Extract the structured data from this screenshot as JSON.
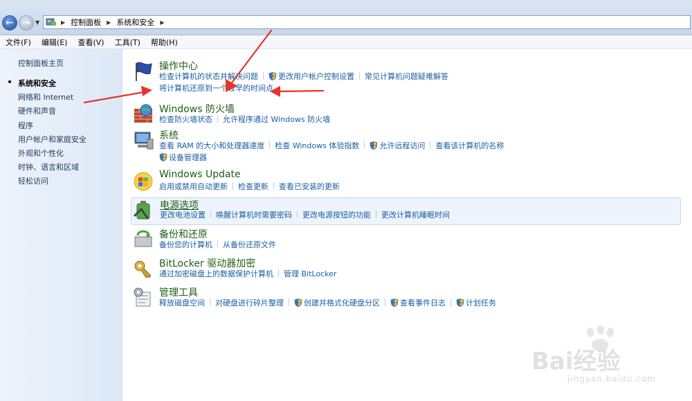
{
  "breadcrumb": {
    "items": [
      "控制面板",
      "系统和安全"
    ]
  },
  "menu": {
    "items": [
      "文件(F)",
      "编辑(E)",
      "查看(V)",
      "工具(T)",
      "帮助(H)"
    ]
  },
  "sidebar": {
    "home": "控制面板主页",
    "items": [
      "系统和安全",
      "网络和 Internet",
      "硬件和声音",
      "程序",
      "用户帐户和家庭安全",
      "外观和个性化",
      "时钟、语言和区域",
      "轻松访问"
    ],
    "current_index": 0
  },
  "categories": [
    {
      "title": "操作中心",
      "icon": "flag-icon",
      "links": [
        {
          "text": "检查计算机的状态并解决问题",
          "shield": false
        },
        {
          "text": "更改用户帐户控制设置",
          "shield": true
        },
        {
          "text": "常见计算机问题疑难解答",
          "shield": false
        },
        {
          "text": "将计算机还原到一个较早的时间点",
          "shield": false,
          "newline": true
        }
      ]
    },
    {
      "title": "Windows 防火墙",
      "icon": "firewall-icon",
      "links": [
        {
          "text": "检查防火墙状态",
          "shield": false
        },
        {
          "text": "允许程序通过 Windows 防火墙",
          "shield": false
        }
      ]
    },
    {
      "title": "系统",
      "icon": "computer-icon",
      "links": [
        {
          "text": "查看 RAM 的大小和处理器速度",
          "shield": false
        },
        {
          "text": "检查 Windows 体验指数",
          "shield": false
        },
        {
          "text": "允许远程访问",
          "shield": true
        },
        {
          "text": "查看该计算机的名称",
          "shield": false
        },
        {
          "text": "设备管理器",
          "shield": true,
          "newline": true
        }
      ]
    },
    {
      "title": "Windows Update",
      "icon": "windows-update-icon",
      "links": [
        {
          "text": "启用或禁用自动更新",
          "shield": false
        },
        {
          "text": "检查更新",
          "shield": false
        },
        {
          "text": "查看已安装的更新",
          "shield": false
        }
      ]
    },
    {
      "title": "电源选项",
      "icon": "battery-icon",
      "highlight": true,
      "links": [
        {
          "text": "更改电池设置",
          "shield": false
        },
        {
          "text": "唤醒计算机时需要密码",
          "shield": false
        },
        {
          "text": "更改电源按钮的功能",
          "shield": false
        },
        {
          "text": "更改计算机睡眠时间",
          "shield": false
        }
      ]
    },
    {
      "title": "备份和还原",
      "icon": "backup-icon",
      "links": [
        {
          "text": "备份您的计算机",
          "shield": false
        },
        {
          "text": "从备份还原文件",
          "shield": false
        }
      ]
    },
    {
      "title": "BitLocker 驱动器加密",
      "icon": "bitlocker-key-icon",
      "links": [
        {
          "text": "通过加密磁盘上的数据保护计算机",
          "shield": false
        },
        {
          "text": "管理 BitLocker",
          "shield": false
        }
      ]
    },
    {
      "title": "管理工具",
      "icon": "admin-tools-icon",
      "links": [
        {
          "text": "释放磁盘空间",
          "shield": false
        },
        {
          "text": "对硬盘进行碎片整理",
          "shield": false
        },
        {
          "text": "创建并格式化硬盘分区",
          "shield": true
        },
        {
          "text": "查看事件日志",
          "shield": true
        },
        {
          "text": "计划任务",
          "shield": true
        }
      ]
    }
  ],
  "colors": {
    "title": "#1e5e14",
    "link": "#1b5ea3",
    "arrow": "#e8332a"
  },
  "watermark": {
    "brand": "Bai经验",
    "url": "jingyan.baidu.com"
  }
}
